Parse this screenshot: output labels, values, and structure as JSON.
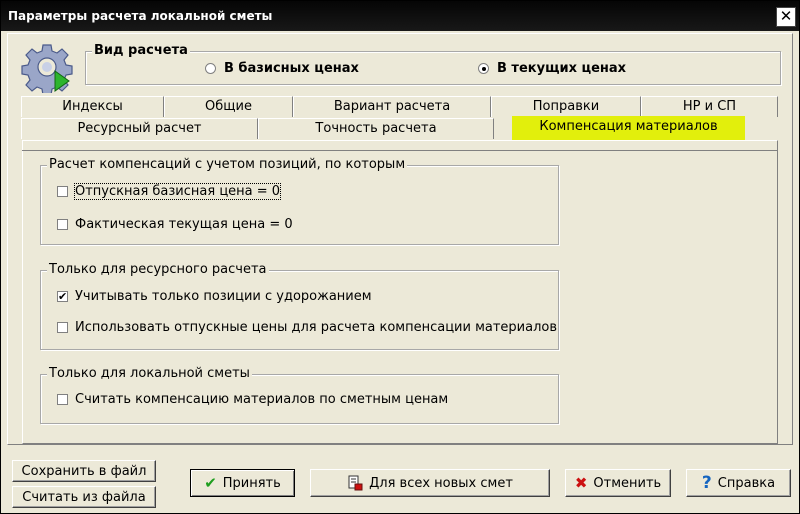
{
  "window": {
    "title": "Параметры расчета локальной сметы",
    "close_glyph": "✕"
  },
  "calc_type": {
    "legend": "Вид расчета",
    "options": [
      {
        "label": "В базисных ценах",
        "selected": false
      },
      {
        "label": "В текущих ценах",
        "selected": true
      }
    ]
  },
  "tabs": {
    "row1": [
      "Индексы",
      "Общие",
      "Вариант расчета",
      "Поправки",
      "НР и СП"
    ],
    "row2": [
      "Ресурсный расчет",
      "Точность расчета",
      "Компенсация материалов"
    ],
    "active": "Компенсация материалов"
  },
  "groups": {
    "positions": {
      "legend": "Расчет компенсаций с учетом позиций, по которым",
      "items": [
        {
          "label": "Отпускная базисная цена = 0",
          "checked": false
        },
        {
          "label": "Фактическая текущая цена = 0",
          "checked": false
        }
      ]
    },
    "resource": {
      "legend": "Только для ресурсного расчета",
      "items": [
        {
          "label": "Учитывать только позиции с удорожанием",
          "checked": true
        },
        {
          "label": "Использовать отпускные цены для расчета компенсации материалов",
          "checked": false
        }
      ]
    },
    "local": {
      "legend": "Только для локальной сметы",
      "items": [
        {
          "label": "Считать компенсацию материалов по сметным ценам",
          "checked": false
        }
      ]
    }
  },
  "buttons": {
    "save_file": "Сохранить в файл",
    "load_file": "Считать из файла",
    "accept": "Принять",
    "all_new": "Для всех новых смет",
    "cancel": "Отменить",
    "help": "Справка"
  },
  "colors": {
    "active_tab": "#E2EF0C",
    "accept_icon": "#1E9E1E",
    "cancel_icon": "#CC1111",
    "help_icon": "#1565C0"
  }
}
